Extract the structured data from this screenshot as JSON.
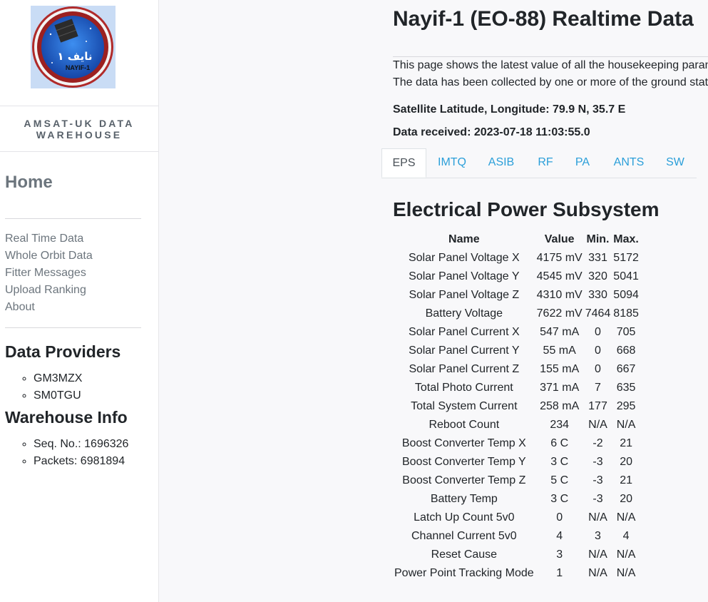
{
  "sidebar": {
    "brand": "AMSAT-UK DATA WAREHOUSE",
    "home": "Home",
    "nav": [
      "Real Time Data",
      "Whole Orbit Data",
      "Fitter Messages",
      "Upload Ranking",
      "About"
    ],
    "providers_heading": "Data Providers",
    "providers": [
      "GM3MZX",
      "SM0TGU"
    ],
    "info_heading": "Warehouse Info",
    "info": [
      "Seq. No.: 1696326",
      "Packets: 6981894"
    ]
  },
  "logo": {
    "text_arabic": "نايف ١",
    "text_latin": "NAYIF-1"
  },
  "main": {
    "title": "Nayif-1 (EO-88) Realtime Data",
    "intro_line1": "This page shows the latest value of all the housekeeping param",
    "intro_line2": "The data has been collected by one or more of the ground stati",
    "lat_long": "Satellite Latitude, Longitude: 79.9 N, 35.7 E",
    "received": "Data received: 2023-07-18 11:03:55.0",
    "tabs": [
      "EPS",
      "IMTQ",
      "ASIB",
      "RF",
      "PA",
      "ANTS",
      "SW"
    ],
    "active_tab": "EPS",
    "section_title": "Electrical Power Subsystem",
    "table": {
      "headers": [
        "Name",
        "Value",
        "Min.",
        "Max."
      ],
      "rows": [
        [
          "Solar Panel Voltage X",
          "4175 mV",
          "331",
          "5172"
        ],
        [
          "Solar Panel Voltage Y",
          "4545 mV",
          "320",
          "5041"
        ],
        [
          "Solar Panel Voltage Z",
          "4310 mV",
          "330",
          "5094"
        ],
        [
          "Battery Voltage",
          "7622 mV",
          "7464",
          "8185"
        ],
        [
          "Solar Panel Current X",
          "547 mA",
          "0",
          "705"
        ],
        [
          "Solar Panel Current Y",
          "55 mA",
          "0",
          "668"
        ],
        [
          "Solar Panel Current Z",
          "155 mA",
          "0",
          "667"
        ],
        [
          "Total Photo Current",
          "371 mA",
          "7",
          "635"
        ],
        [
          "Total System Current",
          "258 mA",
          "177",
          "295"
        ],
        [
          "Reboot Count",
          "234",
          "N/A",
          "N/A"
        ],
        [
          "Boost Converter Temp X",
          "6 C",
          "-2",
          "21"
        ],
        [
          "Boost Converter Temp Y",
          "3 C",
          "-3",
          "20"
        ],
        [
          "Boost Converter Temp Z",
          "5 C",
          "-3",
          "21"
        ],
        [
          "Battery Temp",
          "3 C",
          "-3",
          "20"
        ],
        [
          "Latch Up Count 5v0",
          "0",
          "N/A",
          "N/A"
        ],
        [
          "Channel Current 5v0",
          "4",
          "3",
          "4"
        ],
        [
          "Reset Cause",
          "3",
          "N/A",
          "N/A"
        ],
        [
          "Power Point Tracking Mode",
          "1",
          "N/A",
          "N/A"
        ]
      ]
    }
  },
  "colors": {
    "link": "#2b9fd9",
    "muted": "#6c757d",
    "text": "#212529",
    "logo_ring": "#b02a2a",
    "logo_sky": "#1f63c9"
  }
}
